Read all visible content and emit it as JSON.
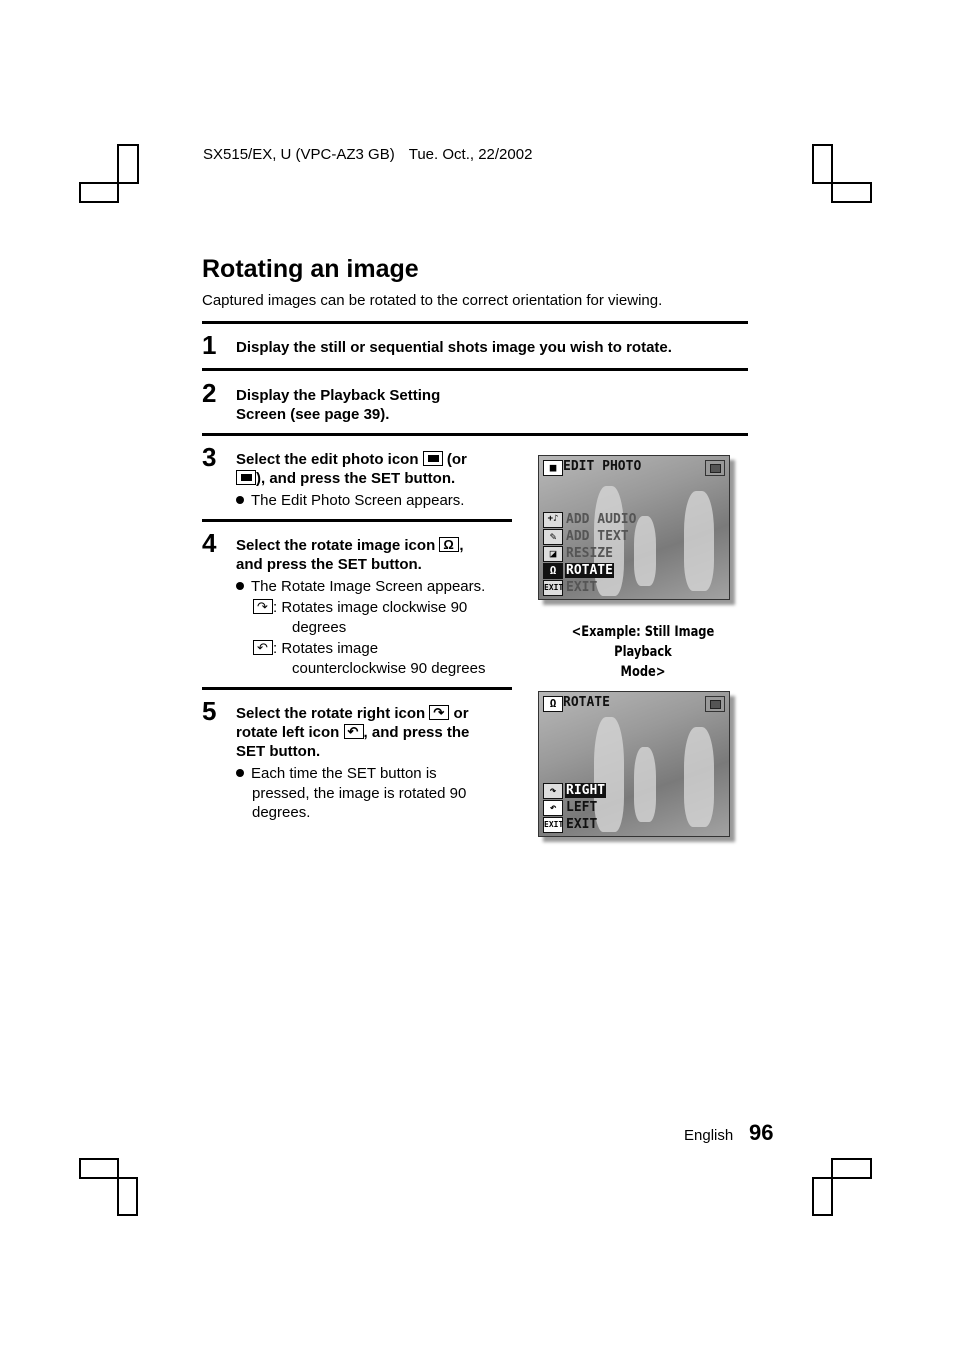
{
  "header": {
    "model": "SX515/EX, U (VPC-AZ3 GB)",
    "date": "Tue. Oct., 22/2002"
  },
  "page_title": "Rotating an image",
  "intro": "Captured images can be rotated to the correct orientation for viewing.",
  "steps": [
    {
      "number": "1",
      "text": "Display the still or sequential shots image you wish to rotate."
    },
    {
      "number": "2",
      "line1": "Display the Playback Setting",
      "line2": "Screen (see page 39)."
    },
    {
      "number": "3",
      "line1a": "Select the edit photo icon",
      "line1b": "(or",
      "line2": "), and press the SET button.",
      "bullets": [
        "The Edit Photo Screen appears."
      ],
      "icons": [
        "edit-photo-icon",
        "edit-photo-sequential-icon"
      ]
    },
    {
      "number": "4",
      "line1a": "Select the rotate image icon",
      "line1b": ",",
      "line2": "and press the SET button.",
      "bullets": [
        "The Rotate Image Screen appears."
      ],
      "sub": [
        {
          "icon": "rotate-right-icon",
          "line1": ": Rotates image clockwise 90",
          "line2": "degrees"
        },
        {
          "icon": "rotate-left-icon",
          "line1": ": Rotates image",
          "line2": "counterclockwise 90 degrees"
        }
      ]
    },
    {
      "number": "5",
      "line1a": "Select the rotate right icon",
      "line1b": "or",
      "line2a": "rotate left icon",
      "line2b": ", and press the",
      "line3": "SET button.",
      "bullets": [
        "Each time the SET button is",
        "pressed, the image is rotated 90",
        "degrees."
      ]
    }
  ],
  "screen1": {
    "title": "EDIT PHOTO",
    "menu": [
      {
        "icon": "+♪",
        "label": "ADD AUDIO"
      },
      {
        "icon": "✎",
        "label": "ADD TEXT"
      },
      {
        "icon": "◪",
        "label": "RESIZE"
      },
      {
        "icon": "Ω",
        "label": "ROTATE",
        "selected": true
      },
      {
        "icon": "EXIT",
        "label": "EXIT"
      }
    ]
  },
  "screen2": {
    "title": "ROTATE",
    "menu": [
      {
        "icon": "↷",
        "label": "RIGHT",
        "selected": true
      },
      {
        "icon": "↶",
        "label": "LEFT"
      },
      {
        "icon": "EXIT",
        "label": "EXIT"
      }
    ]
  },
  "caption": {
    "line1": "<Example: Still Image Playback",
    "line2": "Mode>"
  },
  "footer": {
    "language": "English",
    "page_number": "96"
  }
}
